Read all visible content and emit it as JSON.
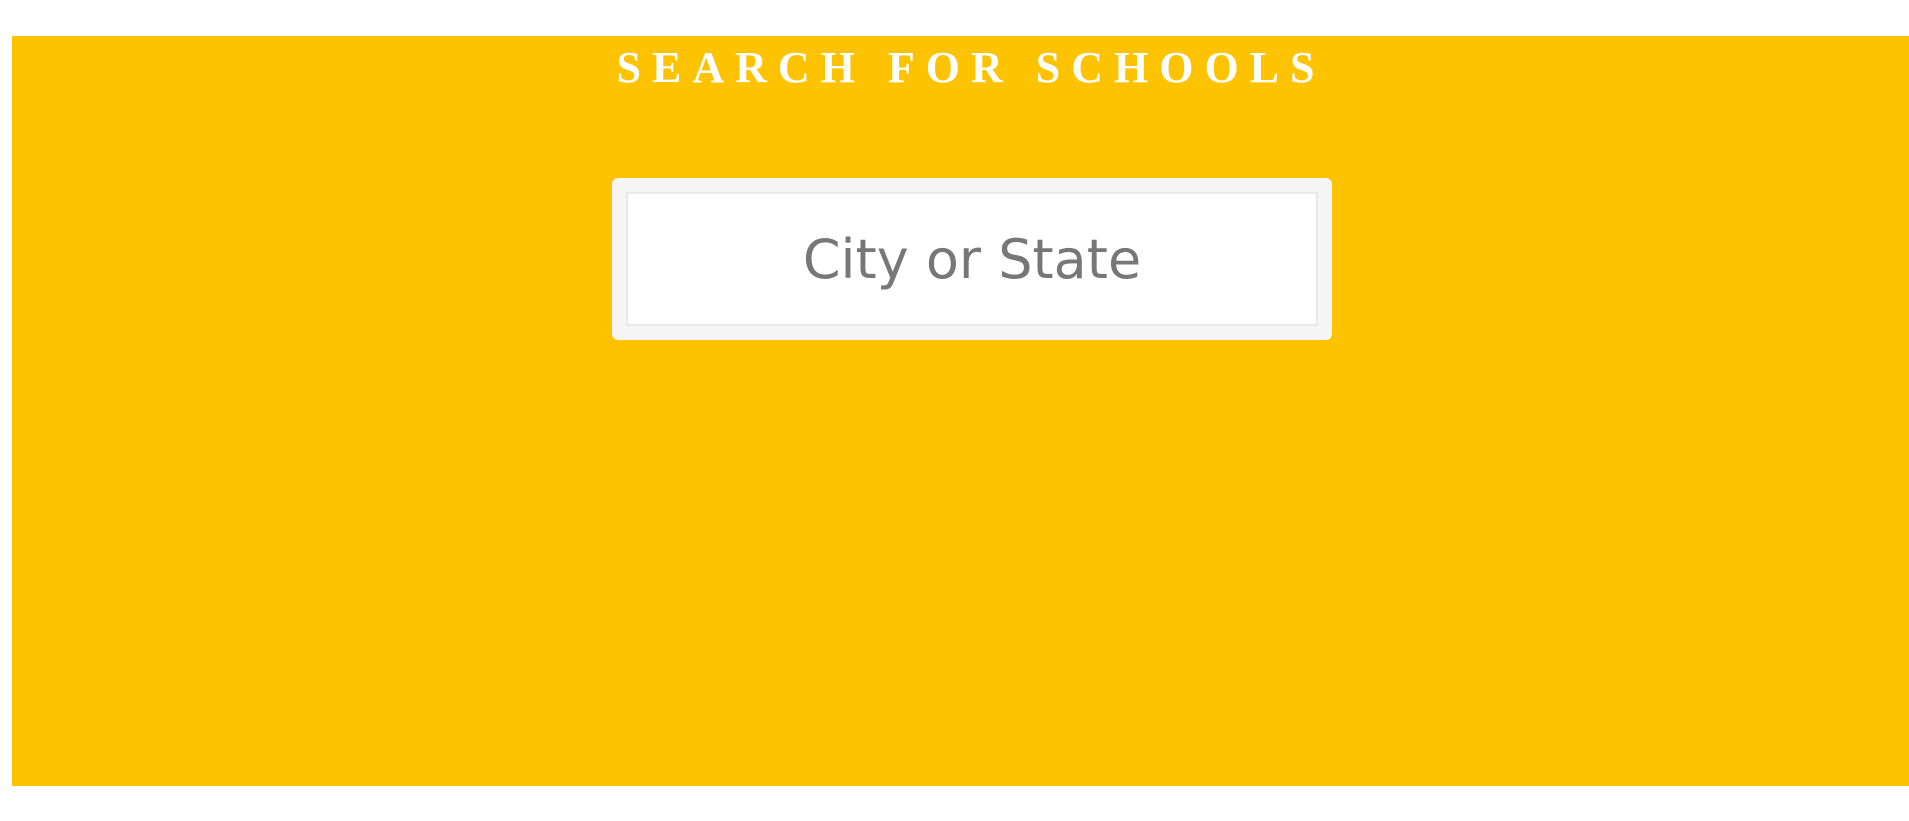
{
  "hero": {
    "title": "SEARCH FOR SCHOOLS"
  },
  "search": {
    "placeholder": "City or State",
    "value": ""
  },
  "colors": {
    "hero_background": "#fdc300",
    "title_text": "#ffffff",
    "search_frame": "#f5f5f5",
    "placeholder_text": "#777777"
  }
}
